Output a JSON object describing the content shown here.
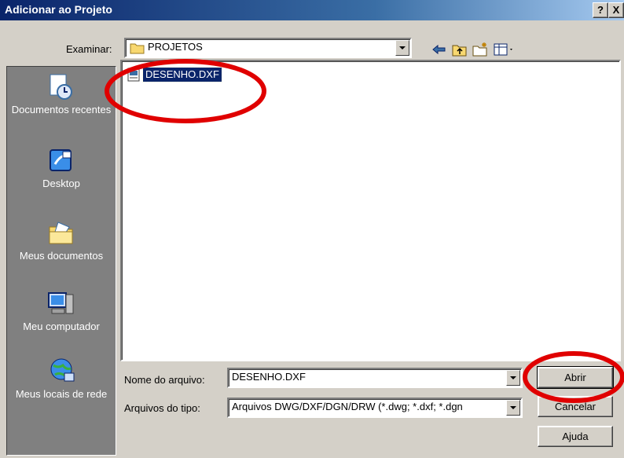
{
  "window": {
    "title": "Adicionar ao Projeto",
    "help_btn": "?",
    "close_btn": "X"
  },
  "lookin": {
    "label": "Examinar:",
    "value": "PROJETOS"
  },
  "toolbar": {
    "icons": [
      "back-arrow-icon",
      "up-folder-icon",
      "new-folder-icon",
      "view-menu-icon"
    ]
  },
  "sidebar": {
    "items": [
      {
        "label": "Documentos recentes",
        "icon": "recent-documents-icon"
      },
      {
        "label": "Desktop",
        "icon": "desktop-icon"
      },
      {
        "label": "Meus documentos",
        "icon": "my-documents-icon"
      },
      {
        "label": "Meu computador",
        "icon": "my-computer-icon"
      },
      {
        "label": "Meus locais de rede",
        "icon": "network-places-icon"
      }
    ]
  },
  "files": [
    {
      "name": "DESENHO.DXF",
      "icon": "dxf-file-icon",
      "selected": true
    }
  ],
  "filename": {
    "label": "Nome do arquivo:",
    "value": "DESENHO.DXF"
  },
  "filetype": {
    "label": "Arquivos do tipo:",
    "value": "Arquivos DWG/DXF/DGN/DRW (*.dwg; *.dxf; *.dgn"
  },
  "buttons": {
    "open": "Abrir",
    "cancel": "Cancelar",
    "help": "Ajuda"
  },
  "colors": {
    "selection": "#0a246a",
    "annotation": "#e00000",
    "face": "#d4d0c8"
  }
}
